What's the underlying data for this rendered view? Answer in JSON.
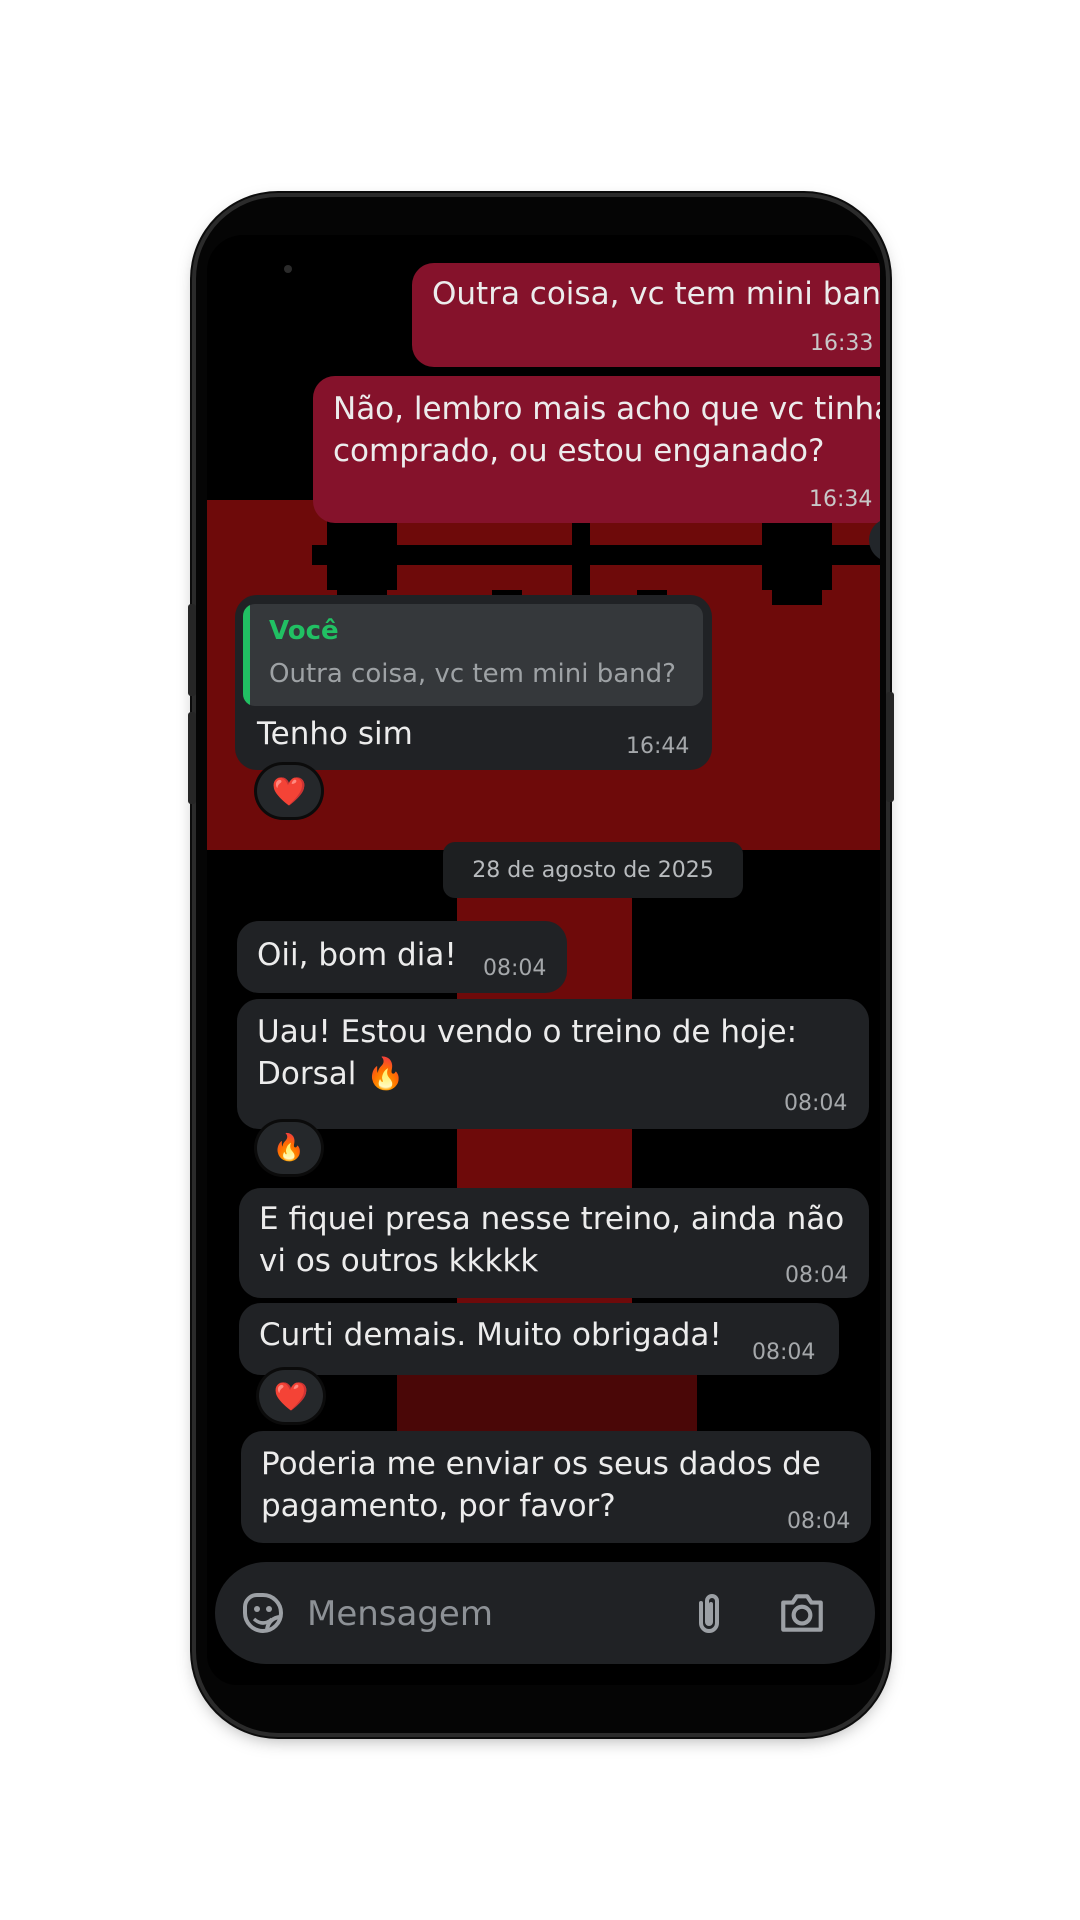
{
  "conversation": {
    "messages_top": [
      {
        "text": "Outra coisa, vc tem mini band?",
        "time": "16:33"
      },
      {
        "text": "Não, lembro mais acho que vc tinha\ncomprado, ou estou enganado?",
        "time": "16:34"
      }
    ],
    "reply": {
      "quoted_author": "Você",
      "quoted_text": "Outra coisa, vc tem mini band?",
      "text": "Tenho sim",
      "time": "16:44",
      "reaction": "❤️"
    },
    "date_separator": "28 de agosto de 2025",
    "messages_bottom": [
      {
        "text": "Oii, bom dia!",
        "time": "08:04"
      },
      {
        "text": "Uau! Estou vendo o treino de hoje:\nDorsal 🔥",
        "time": "08:04",
        "reaction": "🔥"
      },
      {
        "text": "E fiquei presa nesse treino, ainda não\nvi os outros kkkkk",
        "time": "08:04"
      },
      {
        "text": "Curti demais. Muito obrigada!",
        "time": "08:04",
        "reaction": "❤️"
      },
      {
        "text": "Poderia me enviar os seus dados de\npagamento, por favor?",
        "time": "08:04"
      }
    ]
  },
  "composer": {
    "placeholder": "Mensagem",
    "icons": [
      "sticker-icon",
      "attach-icon",
      "camera-icon"
    ]
  },
  "colors": {
    "outgoing_bubble": "#85122b",
    "incoming_bubble": "#202225",
    "quote_accent": "#21c063",
    "wallpaper_red": "#6e0a0a"
  }
}
